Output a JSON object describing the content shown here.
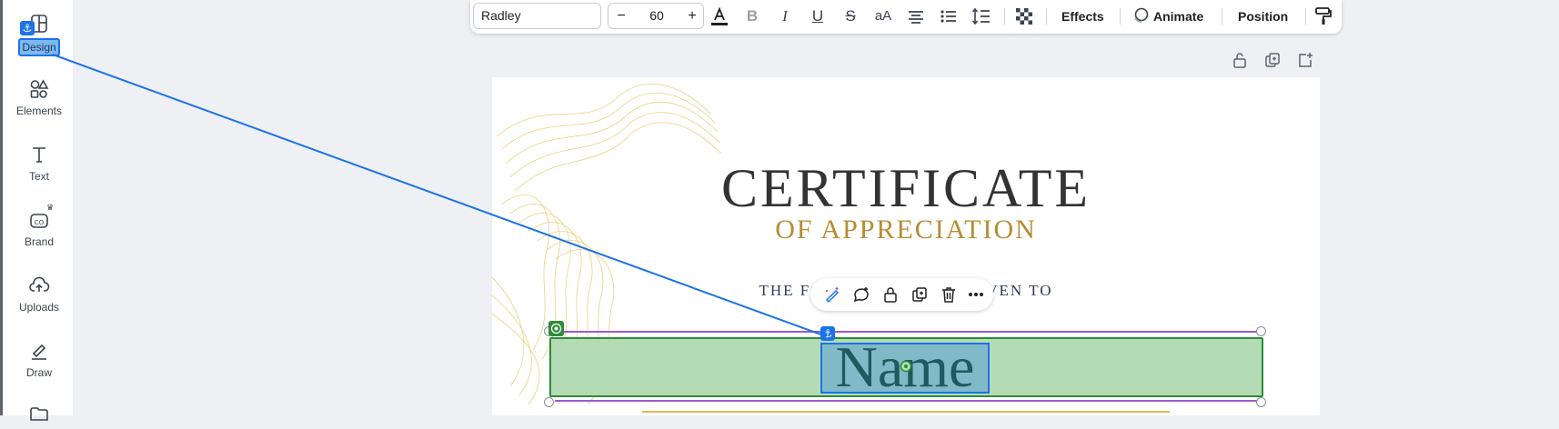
{
  "sidebar": {
    "items": [
      {
        "label": "Design",
        "icon": "design-icon",
        "active": true
      },
      {
        "label": "Elements",
        "icon": "elements-icon"
      },
      {
        "label": "Text",
        "icon": "text-icon"
      },
      {
        "label": "Brand",
        "icon": "brand-icon"
      },
      {
        "label": "Uploads",
        "icon": "uploads-icon"
      },
      {
        "label": "Draw",
        "icon": "draw-icon"
      },
      {
        "label": "",
        "icon": "folder-icon"
      }
    ]
  },
  "toolbar": {
    "font_name": "Radley",
    "font_size": "60",
    "minus": "−",
    "plus": "+",
    "case_label": "aA",
    "effects_label": "Effects",
    "animate_label": "Animate",
    "position_label": "Position"
  },
  "certificate": {
    "title": "CERTIFICATE",
    "subtitle": "OF APPRECIATION",
    "given_left": "THE FOLL",
    "given_right": "GIVEN TO",
    "name": "Name"
  },
  "colors": {
    "accent": "#1a73e8",
    "selection_green": "#2e8b3a",
    "gold": "#b68d32",
    "purple": "#9b59d0"
  }
}
